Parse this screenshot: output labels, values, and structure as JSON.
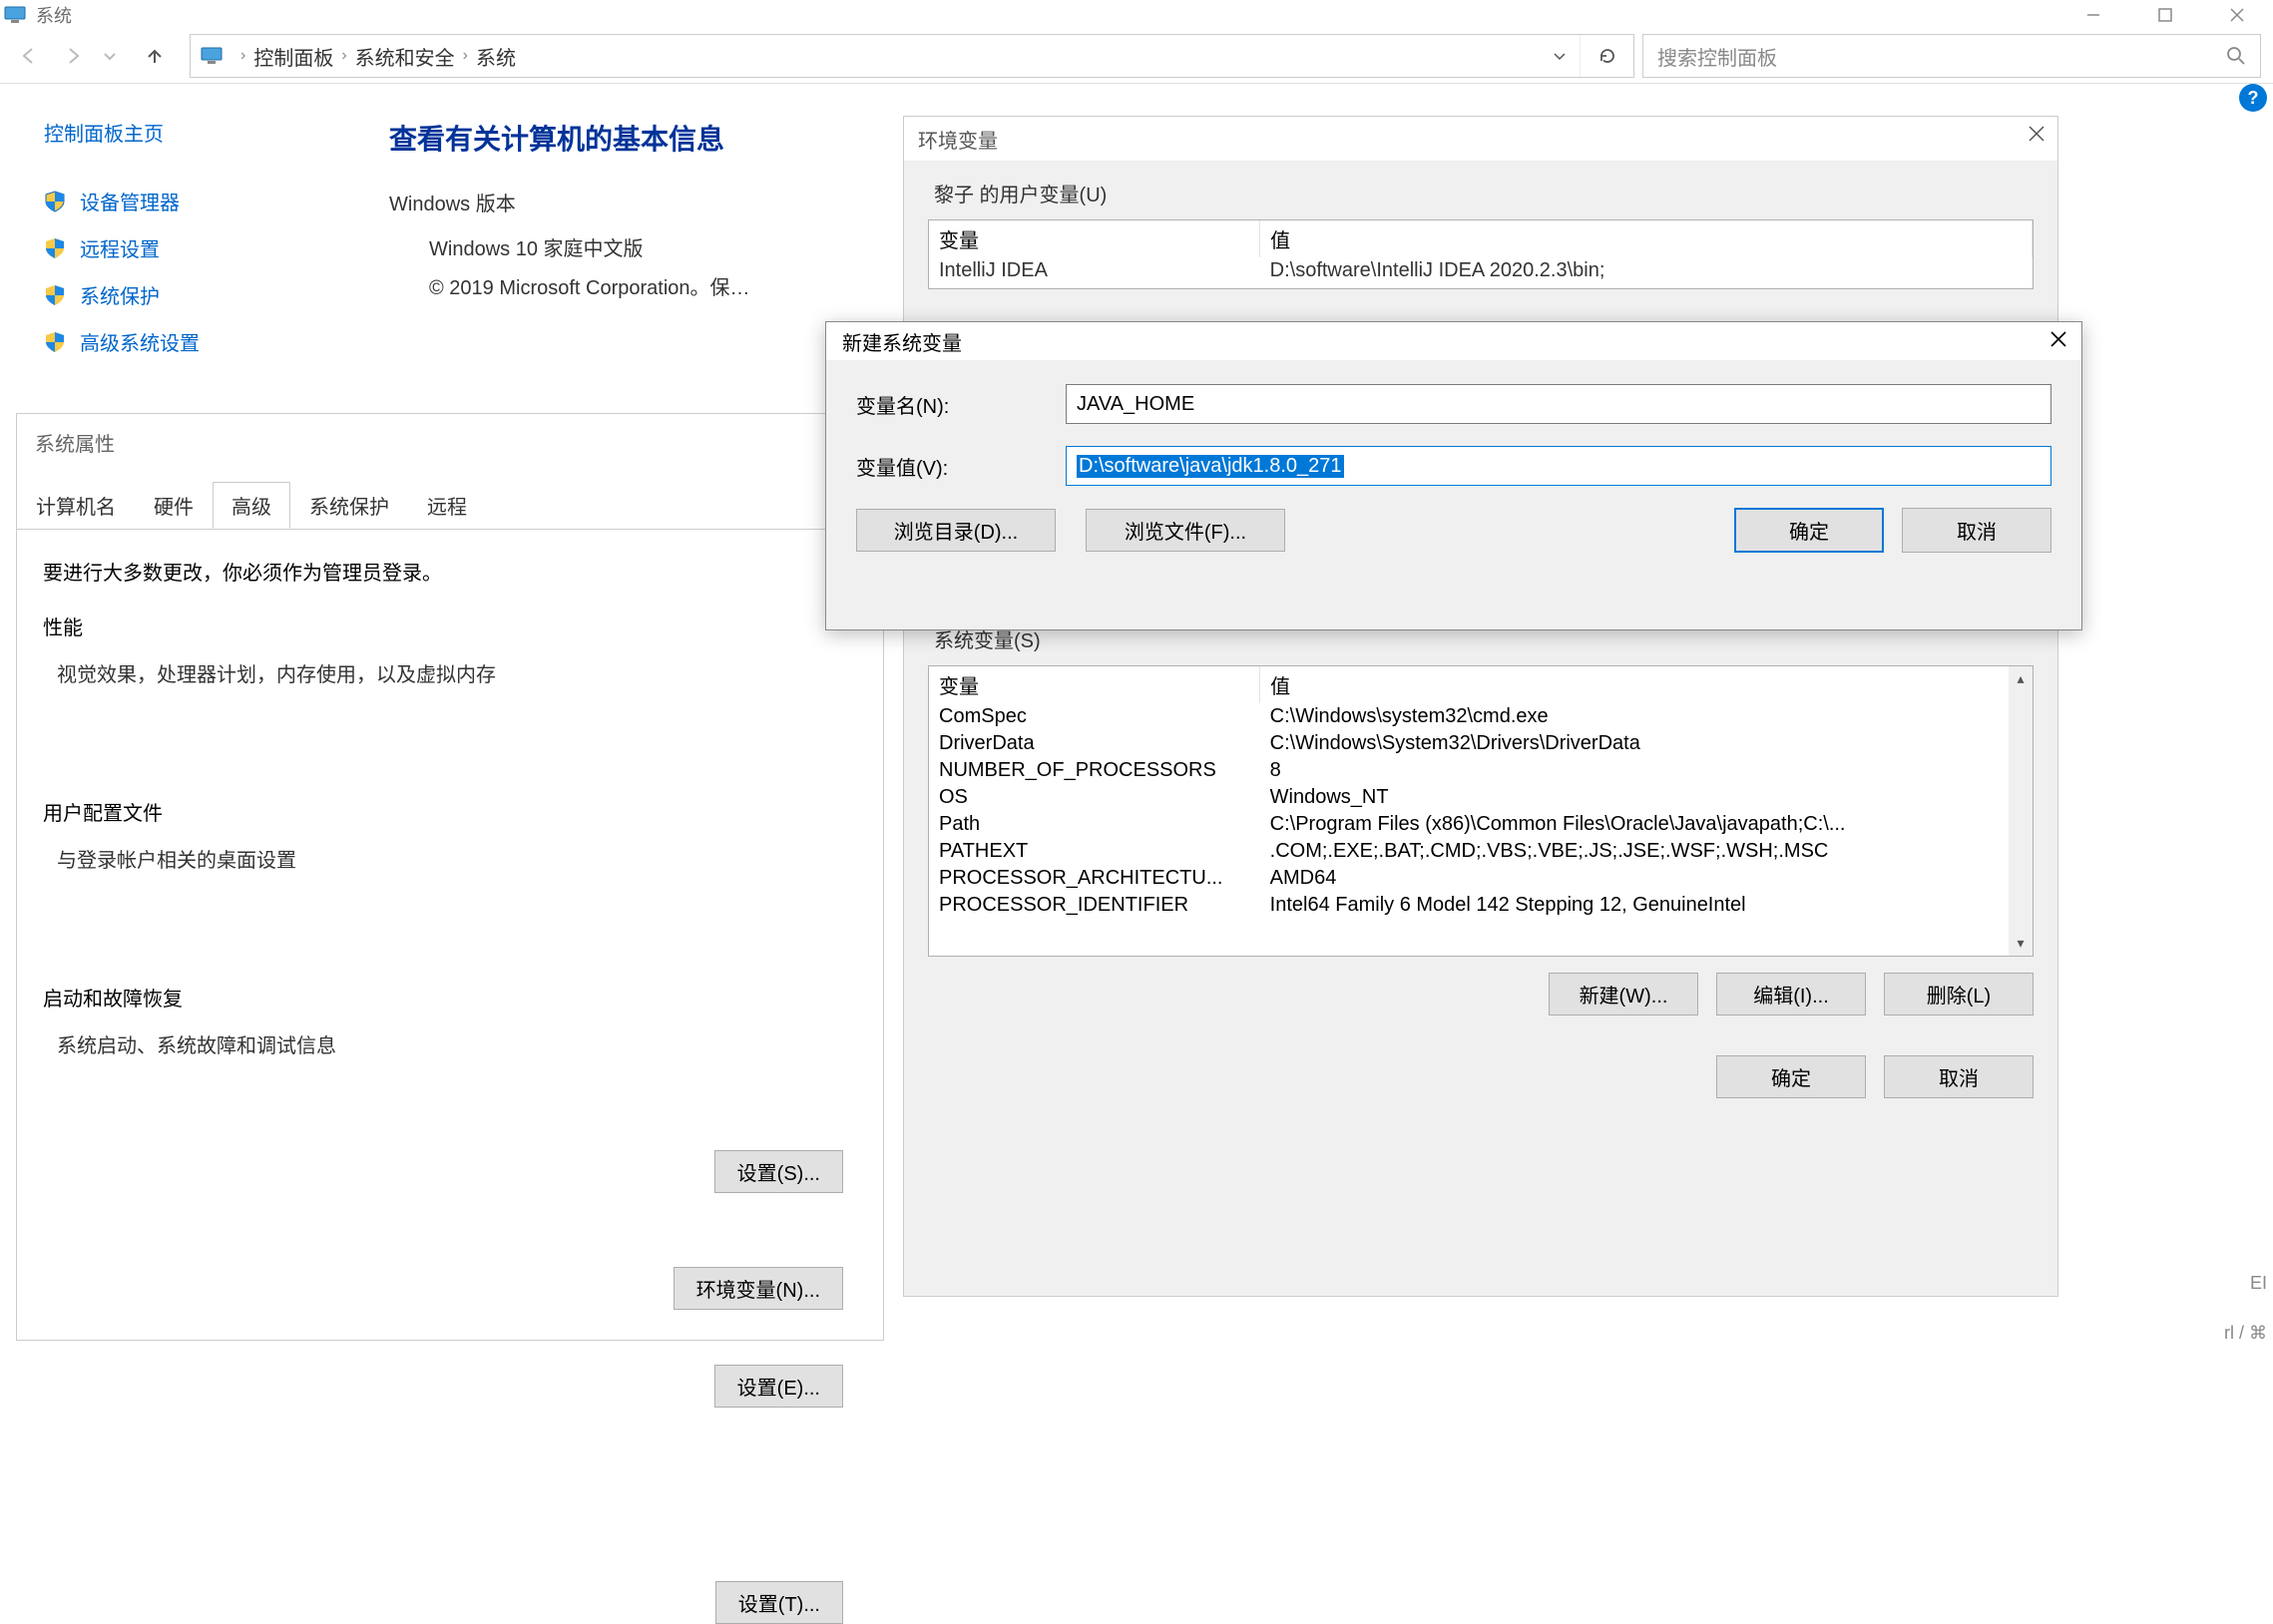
{
  "window": {
    "title": "系统",
    "min": "—",
    "max": "☐",
    "close": "✕"
  },
  "nav": {
    "crumbs": [
      "控制面板",
      "系统和安全",
      "系统"
    ],
    "search_placeholder": "搜索控制面板"
  },
  "left": {
    "home": "控制面板主页",
    "links": [
      "设备管理器",
      "远程设置",
      "系统保护",
      "高级系统设置"
    ]
  },
  "main": {
    "heading": "查看有关计算机的基本信息",
    "win_section": "Windows 版本",
    "win_version": "Windows 10 家庭中文版",
    "win_copy": "© 2019 Microsoft Corporation。保…"
  },
  "sysprops": {
    "title": "系统属性",
    "tabs": [
      "计算机名",
      "硬件",
      "高级",
      "系统保护",
      "远程"
    ],
    "admin_note": "要进行大多数更改，你必须作为管理员登录。",
    "perf_title": "性能",
    "perf_body": "视觉效果，处理器计划，内存使用，以及虚拟内存",
    "perf_btn": "设置(S)...",
    "prof_title": "用户配置文件",
    "prof_body": "与登录帐户相关的桌面设置",
    "prof_btn": "设置(E)...",
    "boot_title": "启动和故障恢复",
    "boot_body": "系统启动、系统故障和调试信息",
    "boot_btn": "设置(T)...",
    "env_btn": "环境变量(N)..."
  },
  "envdlg": {
    "title": "环境变量",
    "user_section": "黎子 的用户变量(U)",
    "col_var": "变量",
    "col_val": "值",
    "user_rows": [
      {
        "var": "IntelliJ IDEA",
        "val": "D:\\software\\IntelliJ IDEA 2020.2.3\\bin;"
      }
    ],
    "sys_section": "系统变量(S)",
    "sys_rows": [
      {
        "var": "ComSpec",
        "val": "C:\\Windows\\system32\\cmd.exe"
      },
      {
        "var": "DriverData",
        "val": "C:\\Windows\\System32\\Drivers\\DriverData"
      },
      {
        "var": "NUMBER_OF_PROCESSORS",
        "val": "8"
      },
      {
        "var": "OS",
        "val": "Windows_NT"
      },
      {
        "var": "Path",
        "val": "C:\\Program Files (x86)\\Common Files\\Oracle\\Java\\javapath;C:\\..."
      },
      {
        "var": "PATHEXT",
        "val": ".COM;.EXE;.BAT;.CMD;.VBS;.VBE;.JS;.JSE;.WSF;.WSH;.MSC"
      },
      {
        "var": "PROCESSOR_ARCHITECTU...",
        "val": "AMD64"
      },
      {
        "var": "PROCESSOR_IDENTIFIER",
        "val": "Intel64 Family 6 Model 142 Stepping 12, GenuineIntel"
      }
    ],
    "btn_new": "新建(W)...",
    "btn_edit": "编辑(I)...",
    "btn_del": "删除(L)",
    "btn_ok": "确定",
    "btn_cancel": "取消"
  },
  "newvar": {
    "title": "新建系统变量",
    "lbl_name": "变量名(N):",
    "val_name": "JAVA_HOME",
    "lbl_val": "变量值(V):",
    "val_val": "D:\\software\\java\\jdk1.8.0_271",
    "btn_dir": "浏览目录(D)...",
    "btn_file": "浏览文件(F)...",
    "btn_ok": "确定",
    "btn_cancel": "取消"
  },
  "rightstrip": {
    "el": "EI",
    "ctrl": "rl / ⌘"
  },
  "help": "?"
}
